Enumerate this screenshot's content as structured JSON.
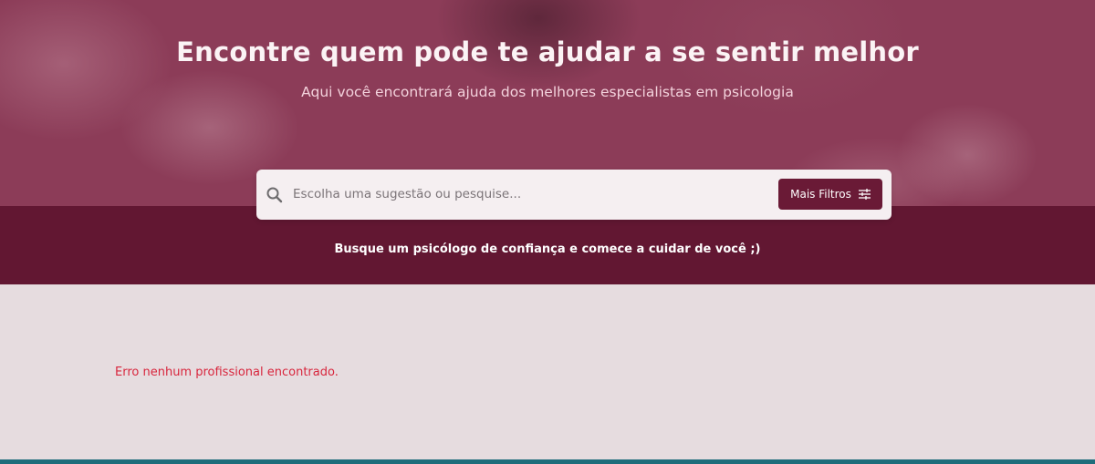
{
  "hero": {
    "title": "Encontre quem pode te ajudar a se sentir melhor",
    "subtitle": "Aqui você encontrará ajuda dos melhores especialistas em psicologia"
  },
  "search": {
    "placeholder": "Escolha uma sugestão ou pesquise...",
    "value": "",
    "filter_button_label": "Mais Filtros",
    "search_icon": "search-icon",
    "filter_icon": "sliders-icon"
  },
  "band": {
    "tagline": "Busque um psicólogo de confiança e comece a cuidar de você ;)"
  },
  "results": {
    "error_message": "Erro nenhum profissional encontrado."
  },
  "colors": {
    "hero_overlay": "#8c3c58",
    "brand": "#621732",
    "button": "#6a1a36",
    "page_background": "#e6dcdf",
    "error": "#d8263d",
    "footer_accent": "#1f6d7b"
  }
}
